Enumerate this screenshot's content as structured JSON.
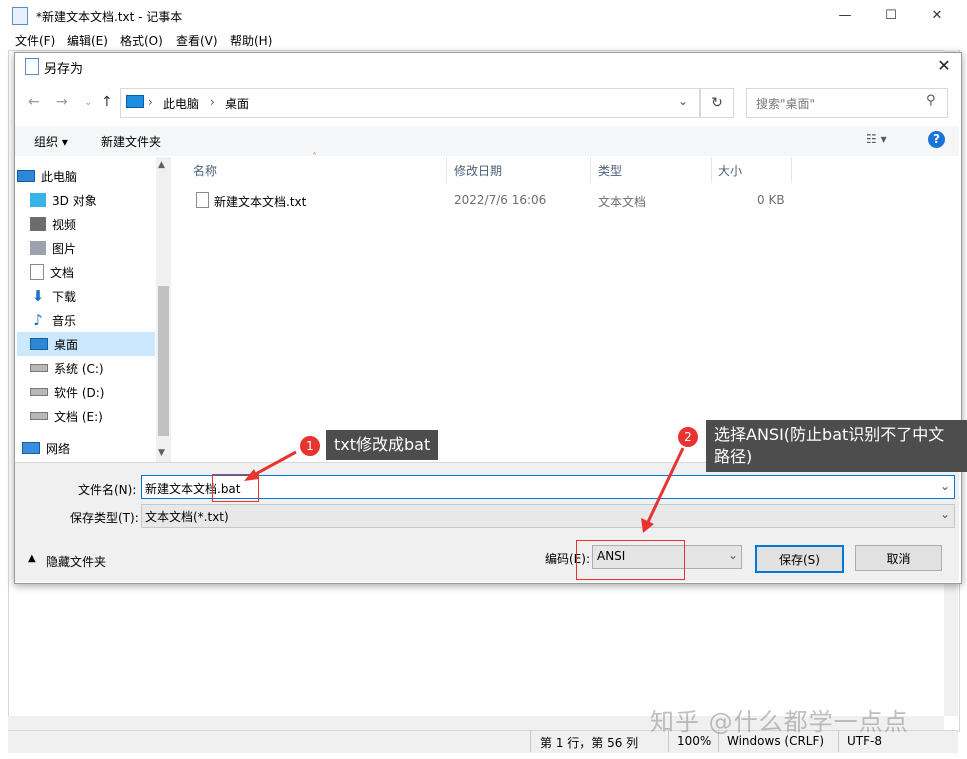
{
  "notepad": {
    "title": "*新建文本文档.txt - 记事本",
    "menus": [
      "文件(F)",
      "编辑(E)",
      "格式(O)",
      "查看(V)",
      "帮助(H)"
    ],
    "status": {
      "position": "第 1 行，第 56 列",
      "zoom": "100%",
      "line_ending": "Windows (CRLF)",
      "encoding": "UTF-8"
    }
  },
  "dialog": {
    "title": "另存为",
    "breadcrumb": [
      "此电脑",
      "桌面"
    ],
    "search_placeholder": "搜索\"桌面\"",
    "toolbar": {
      "organize": "组织 ▾",
      "new_folder": "新建文件夹"
    },
    "nav": [
      {
        "label": "此电脑",
        "icon": "computer-icon"
      },
      {
        "label": "3D 对象",
        "icon": "3d-objects-icon"
      },
      {
        "label": "视频",
        "icon": "video-icon"
      },
      {
        "label": "图片",
        "icon": "picture-icon"
      },
      {
        "label": "文档",
        "icon": "document-icon"
      },
      {
        "label": "下载",
        "icon": "download-icon"
      },
      {
        "label": "音乐",
        "icon": "music-icon"
      },
      {
        "label": "桌面",
        "icon": "desktop-icon",
        "selected": true
      },
      {
        "label": "系统 (C:)",
        "icon": "drive-icon"
      },
      {
        "label": "软件 (D:)",
        "icon": "drive-icon"
      },
      {
        "label": "文档 (E:)",
        "icon": "drive-icon"
      },
      {
        "label": "网络",
        "icon": "network-icon"
      }
    ],
    "columns": {
      "name": "名称",
      "modified": "修改日期",
      "type": "类型",
      "size": "大小"
    },
    "files": [
      {
        "name": "新建文本文档.txt",
        "modified": "2022/7/6 16:06",
        "type": "文本文档",
        "size": "0 KB"
      }
    ],
    "filename_label": "文件名(N):",
    "filename_value": "新建文本文档.bat",
    "filetype_label": "保存类型(T):",
    "filetype_value": "文本文档(*.txt)",
    "hide_folders": "隐藏文件夹",
    "encoding_label": "编码(E):",
    "encoding_value": "ANSI",
    "save_button": "保存(S)",
    "cancel_button": "取消"
  },
  "annotations": {
    "step1_number": "1",
    "step1_text": "txt修改成bat",
    "step2_number": "2",
    "step2_text": "选择ANSI(防止bat识别不了中文路径)",
    "accent_color": "#e8342f"
  },
  "watermark": "知乎 @什么都学一点点"
}
